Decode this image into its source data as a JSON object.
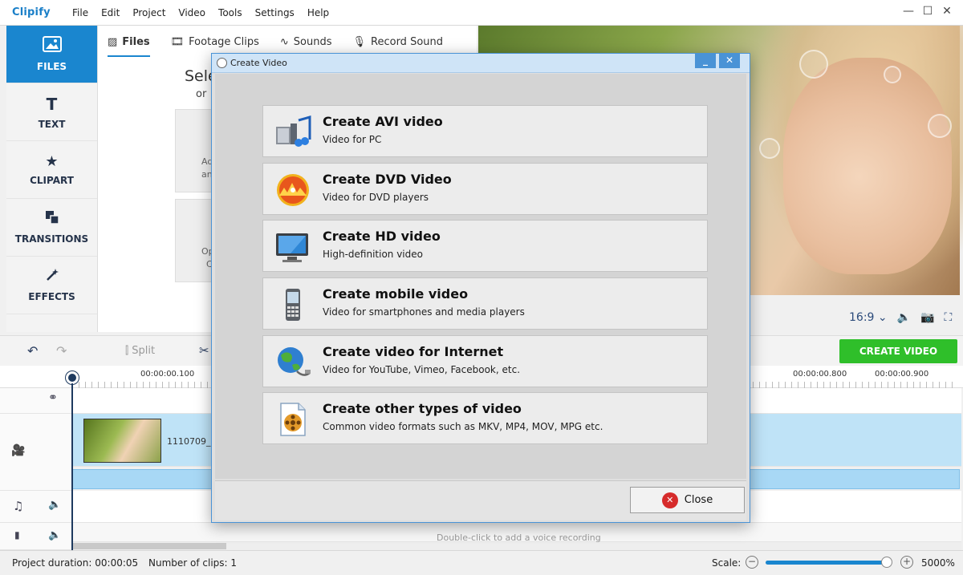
{
  "app": {
    "logo": "Clipify"
  },
  "menu": [
    "File",
    "Edit",
    "Project",
    "Video",
    "Tools",
    "Settings",
    "Help"
  ],
  "window_controls": {
    "minimize": "—",
    "maximize": "☐",
    "close": "✕"
  },
  "sidebar": {
    "items": [
      {
        "label": "FILES",
        "icon": "image-icon",
        "active": true
      },
      {
        "label": "TEXT",
        "icon": "text-icon"
      },
      {
        "label": "CLIPART",
        "icon": "star-icon"
      },
      {
        "label": "TRANSITIONS",
        "icon": "transitions-icon"
      },
      {
        "label": "EFFECTS",
        "icon": "magic-wand-icon"
      }
    ]
  },
  "tabs": [
    {
      "label": "Files",
      "icon": "image-icon",
      "active": true
    },
    {
      "label": "Footage Clips",
      "icon": "film-icon"
    },
    {
      "label": "Sounds",
      "icon": "waveform-icon"
    },
    {
      "label": "Record Sound",
      "icon": "microphone-icon"
    }
  ],
  "files_pane": {
    "title": "Sele",
    "subtitle": "or",
    "tile1_text": "Ad",
    "tile1_text2": "an",
    "tile2_text": "Op",
    "tile2_text2": "C"
  },
  "preview_controls": {
    "aspect": "16:9 ⌄",
    "volume_icon": "speaker-icon",
    "snapshot_icon": "camera-icon",
    "fullscreen_icon": "fullscreen-icon"
  },
  "toolbar": {
    "split": "Split",
    "create_video": "CREATE VIDEO"
  },
  "timeline": {
    "ticks": [
      "00:00:00.100",
      "00:00:00.800",
      "00:00:00.900"
    ],
    "clip_name": "1110709_S",
    "voice_hint": "Double-click to add a voice recording"
  },
  "status": {
    "project_duration_label": "Project duration:",
    "project_duration": "00:00:05",
    "clips_label": "Number of clips:",
    "clips": "1",
    "scale_label": "Scale:",
    "zoom": "5000%",
    "zoom_fraction": 0.97
  },
  "dialog": {
    "title": "Create Video",
    "options": [
      {
        "title": "Create AVI video",
        "subtitle": "Video for PC",
        "icon": "avi-icon"
      },
      {
        "title": "Create DVD Video",
        "subtitle": "Video for DVD players",
        "icon": "dvd-icon"
      },
      {
        "title": "Create HD video",
        "subtitle": "High-definition video",
        "icon": "hd-monitor-icon"
      },
      {
        "title": "Create mobile video",
        "subtitle": "Video for smartphones and media players",
        "icon": "mobile-phone-icon"
      },
      {
        "title": "Create video for Internet",
        "subtitle": "Video for YouTube, Vimeo, Facebook, etc.",
        "icon": "globe-icon"
      },
      {
        "title": "Create other types of video",
        "subtitle": "Common video formats such as MKV, MP4, MOV, MPG etc.",
        "icon": "film-reel-icon"
      }
    ],
    "close_label": "Close"
  }
}
